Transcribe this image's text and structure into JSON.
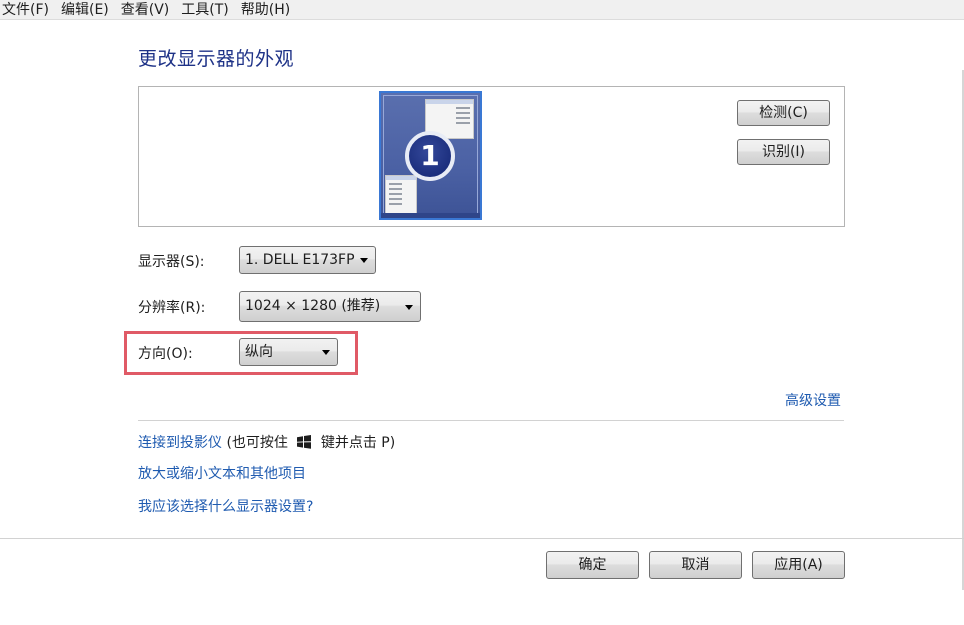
{
  "menu": {
    "items": [
      {
        "label": "文件(F)"
      },
      {
        "label": "编辑(E)"
      },
      {
        "label": "查看(V)"
      },
      {
        "label": "工具(T)"
      },
      {
        "label": "帮助(H)"
      }
    ]
  },
  "page_title": "更改显示器的外观",
  "preview": {
    "monitor_number": "1",
    "detect_button": "检测(C)",
    "identify_button": "识别(I)"
  },
  "form": {
    "display_label": "显示器(S):",
    "display_value": "1. DELL E173FP",
    "resolution_label": "分辨率(R):",
    "resolution_value": "1024 × 1280 (推荐)",
    "orientation_label": "方向(O):",
    "orientation_value": "纵向"
  },
  "highlight_color": "#e05a66",
  "link_color": "#1f5bb0",
  "title_color": "#1e3287",
  "advanced_settings_link": "高级设置",
  "links": {
    "projector_link": "连接到投影仪",
    "projector_hint_before": "(也可按住",
    "projector_hint_icon": "windows-logo-icon",
    "projector_hint_after": "键并点击 P)",
    "text_size_link": "放大或缩小文本和其他项目",
    "which_settings_link": "我应该选择什么显示器设置?"
  },
  "buttons": {
    "ok": "确定",
    "cancel": "取消",
    "apply": "应用(A)"
  }
}
